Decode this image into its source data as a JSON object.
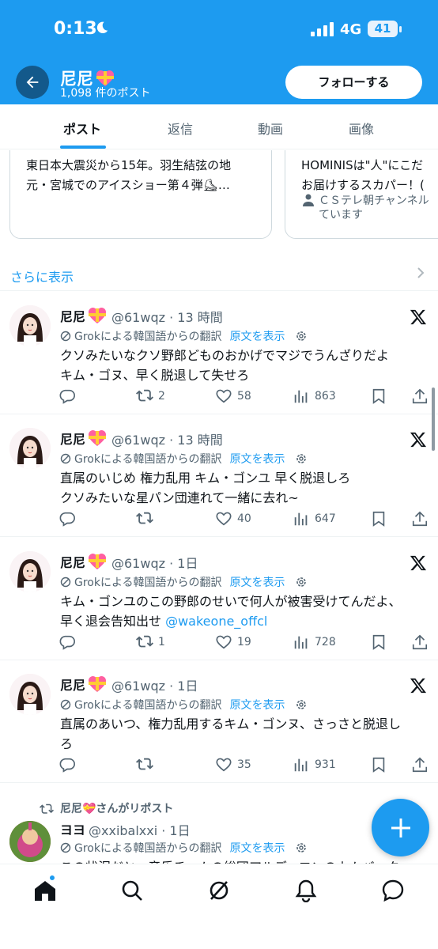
{
  "status_bar": {
    "time": "0:13",
    "network": "4G",
    "battery": "41"
  },
  "header": {
    "name": "尼尼",
    "post_count": "1,098 件のポスト",
    "follow_label": "フォローする"
  },
  "tabs": [
    {
      "label": "ポスト"
    },
    {
      "label": "返信"
    },
    {
      "label": "動画"
    },
    {
      "label": "画像"
    }
  ],
  "cards": [
    {
      "text": "東日本大震災から15年。羽生結弦の地\n元・宮城でのアイスショー第４弾⛸…"
    },
    {
      "text": "HOMINISは\"人\"にこだ\nお届けするスカパー！(",
      "meta": "ＣＳテレ朝チャンネル\nています"
    }
  ],
  "show_more": "さらに表示",
  "translation": {
    "label": "Grokによる韓国語からの翻訳",
    "link": "原文を表示"
  },
  "tweets": [
    {
      "name": "尼尼",
      "handle": "@61wqz · 13 時間",
      "body": "クソみたいなクソ野郎どものおかげでマジでうんざりだよ\nキム・ゴヌ、早く脱退して失せろ",
      "replies": "",
      "reposts": "2",
      "likes": "58",
      "views": "863"
    },
    {
      "name": "尼尼",
      "handle": "@61wqz · 13 時間",
      "body": "直属のいじめ 権力乱用 キム・ゴンユ 早く脱退しろ\nクソみたいな星パン団連れて一緒に去れ~",
      "replies": "",
      "reposts": "",
      "likes": "40",
      "views": "647"
    },
    {
      "name": "尼尼",
      "handle": "@61wqz · 1日",
      "body": "キム・ゴンユのこの野郎のせいで何人が被害受けてんだよ、\n早く退会告知出せ ",
      "mention": "@wakeone_offcl",
      "replies": "",
      "reposts": "1",
      "likes": "19",
      "views": "728"
    },
    {
      "name": "尼尼",
      "handle": "@61wqz · 1日",
      "body": "直属のあいつ、権力乱用するキム・ゴンヌ、さっさと脱退し\nろ",
      "replies": "",
      "reposts": "",
      "likes": "35",
      "views": "931"
    }
  ],
  "repost_tweet": {
    "repost_label": "尼尼💝さんがリポスト",
    "name": "ヨヨ",
    "handle": "@xxibalxxi · 1日",
    "body": "この状況だと、音乐チームの総団アルディロンのカムバック"
  },
  "colors": {
    "accent": "#1d9bf0",
    "text": "#0f1419",
    "muted": "#536471"
  }
}
